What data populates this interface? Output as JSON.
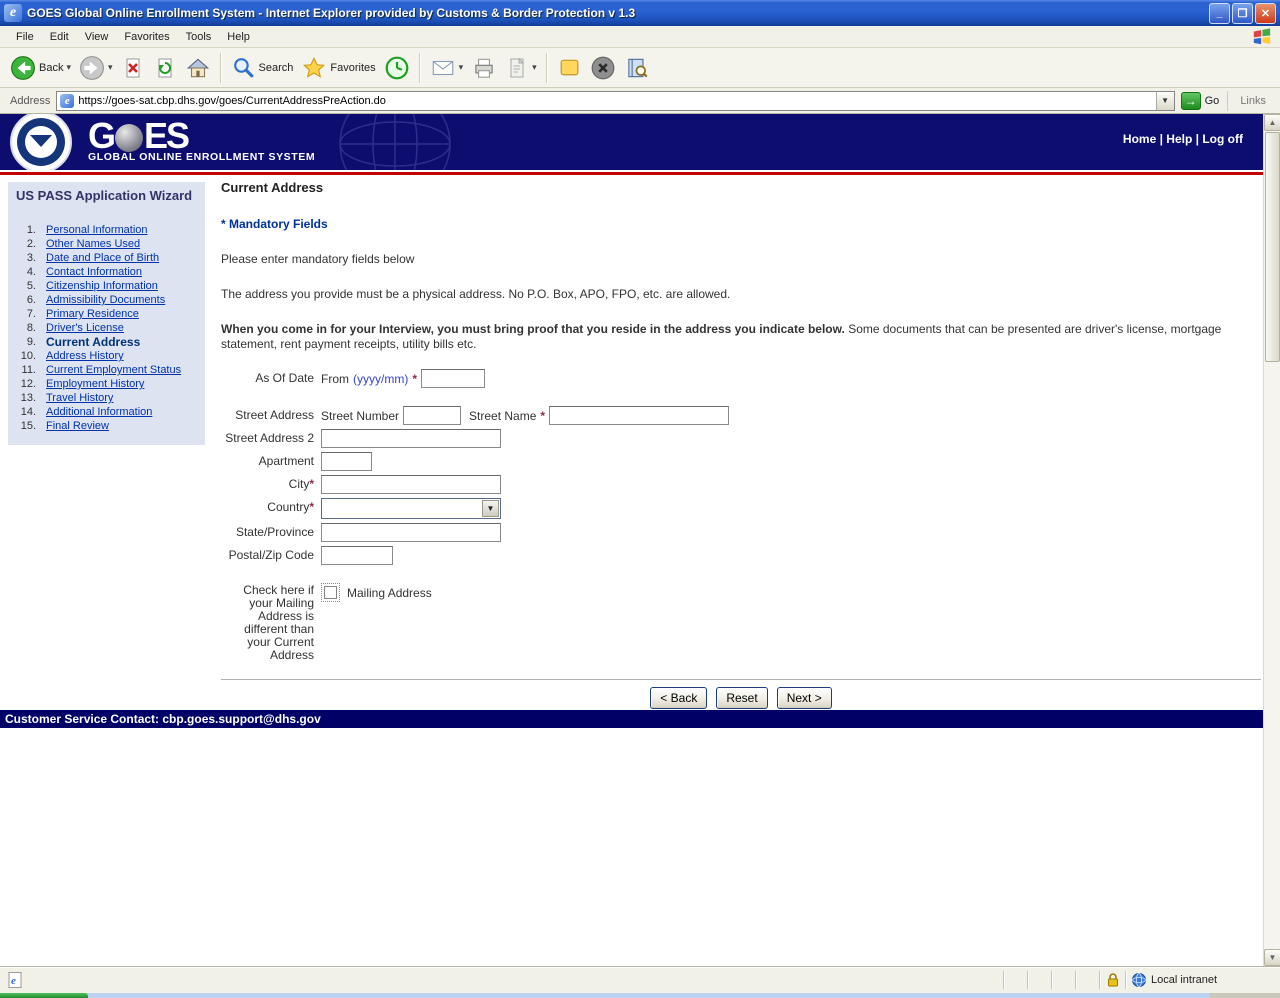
{
  "titlebar": {
    "title": "GOES Global Online Enrollment System - Internet Explorer provided by Customs & Border Protection v 1.3"
  },
  "menu": [
    "File",
    "Edit",
    "View",
    "Favorites",
    "Tools",
    "Help"
  ],
  "toolbar": {
    "back": "Back",
    "search": "Search",
    "favorites": "Favorites"
  },
  "addressbar": {
    "label": "Address",
    "url": "https://goes-sat.cbp.dhs.gov/goes/CurrentAddressPreAction.do",
    "go": "Go",
    "links": "Links"
  },
  "banner": {
    "logo_g": "G",
    "logo_es": "ES",
    "subtitle": "GLOBAL ONLINE ENROLLMENT SYSTEM",
    "nav": [
      "Home",
      "Help",
      "Log off"
    ],
    "nav_sep": " | "
  },
  "sidebar": {
    "title": "US PASS Application Wizard",
    "steps": [
      {
        "num": "1.",
        "label": "Personal Information",
        "current": false
      },
      {
        "num": "2.",
        "label": "Other Names Used",
        "current": false
      },
      {
        "num": "3.",
        "label": "Date and Place of Birth",
        "current": false
      },
      {
        "num": "4.",
        "label": "Contact Information",
        "current": false
      },
      {
        "num": "5.",
        "label": "Citizenship Information",
        "current": false
      },
      {
        "num": "6.",
        "label": "Admissibility Documents",
        "current": false
      },
      {
        "num": "7.",
        "label": "Primary Residence",
        "current": false
      },
      {
        "num": "8.",
        "label": "Driver's License",
        "current": false
      },
      {
        "num": "9.",
        "label": "Current Address",
        "current": true
      },
      {
        "num": "10.",
        "label": "Address History",
        "current": false
      },
      {
        "num": "11.",
        "label": "Current Employment Status",
        "current": false
      },
      {
        "num": "12.",
        "label": "Employment History",
        "current": false
      },
      {
        "num": "13.",
        "label": "Travel History",
        "current": false
      },
      {
        "num": "14.",
        "label": "Additional Information",
        "current": false
      },
      {
        "num": "15.",
        "label": "Final Review",
        "current": false
      }
    ]
  },
  "main": {
    "title": "Current Address",
    "mandatory": "* Mandatory Fields",
    "line1": "Please enter mandatory fields below",
    "line2": "The address you provide must be a physical address. No P.O. Box, APO, FPO, etc. are allowed.",
    "interview_bold": "When you come in for your Interview, you must bring proof that you reside in the address you indicate below.",
    "interview_rest": " Some documents that can be presented are driver's license, mortgage statement, rent payment receipts, utility bills etc.",
    "form": {
      "as_of_date": "As Of Date",
      "from": "From",
      "from_fmt": "(yyyy/mm)",
      "star": "*",
      "street_address": "Street Address",
      "street_number": "Street Number",
      "street_name": "Street Name",
      "street_address2": "Street Address 2",
      "apartment": "Apartment",
      "city": "City",
      "country": "Country",
      "state": "State/Province",
      "postal": "Postal/Zip Code",
      "mailing_question": "Check here if your Mailing Address is different than your Current Address",
      "mailing_label": "Mailing Address"
    },
    "buttons": {
      "back": "< Back",
      "reset": "Reset",
      "next": "Next >"
    }
  },
  "footer": {
    "text": "Customer Service Contact: cbp.goes.support@dhs.gov"
  },
  "statusbar": {
    "zone": "Local intranet"
  },
  "colors": {
    "banner_navy": "#0d0d70",
    "accent_red": "#c00000",
    "link_blue": "#0033aa"
  }
}
